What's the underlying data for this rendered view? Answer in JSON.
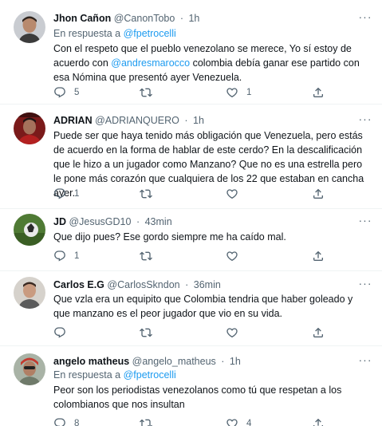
{
  "tweets": [
    {
      "name": "Jhon Cañon",
      "handle": "@CanonTobo",
      "dot": "·",
      "time": "1h",
      "reply_prefix": "En respuesta a",
      "reply_to": "@fpetrocelli",
      "text_1": "Con el respeto que el pueblo venezolano se merece, Yo sí estoy de acuerdo con ",
      "mention": "@andresmarocco",
      "text_2": "  colombia debía ganar ese partido con esa Nómina que presentó ayer  Venezuela.",
      "replies": "5",
      "retweets": "",
      "likes": "1"
    },
    {
      "name": "ADRIAN",
      "handle": "@ADRIANQUERO",
      "dot": "·",
      "time": "1h",
      "text": "Puede ser que haya tenido más obligación que Venezuela, pero estás de acuerdo en la forma de hablar de este cerdo? En la descalificación que le hizo a un jugador como Manzano? Que no es una estrella pero le pone más corazón que cualquiera de los 22 que estaban en cancha ayer.",
      "replies": "1",
      "retweets": "",
      "likes": ""
    },
    {
      "name": "JD",
      "handle": "@JesusGD10",
      "dot": "·",
      "time": "43min",
      "text": "Que dijo pues? Ese gordo siempre me ha caído mal.",
      "replies": "1",
      "retweets": "",
      "likes": ""
    },
    {
      "name": "Carlos E.G",
      "handle": "@CarlosSkndon",
      "dot": "·",
      "time": "36min",
      "text": "Que vzla era un equipito que Colombia tendria que haber goleado y que manzano es el peor jugador que vio en su vida.",
      "replies": "",
      "retweets": "",
      "likes": ""
    },
    {
      "name": "angelo matheus",
      "handle": "@angelo_matheus",
      "dot": "·",
      "time": "1h",
      "reply_prefix": "En respuesta a",
      "reply_to": "@fpetrocelli",
      "text": "Peor son los periodistas venezolanos como tú que respetan a los colombianos que nos insultan",
      "replies": "8",
      "retweets": "",
      "likes": "4"
    }
  ],
  "more_glyph": "···",
  "colors": {
    "accent": "#1d9bf0",
    "secondary_text": "#536471",
    "divider": "#eff3f4"
  },
  "icons": [
    "reply-icon",
    "retweet-icon",
    "like-icon",
    "share-icon",
    "more-icon"
  ]
}
